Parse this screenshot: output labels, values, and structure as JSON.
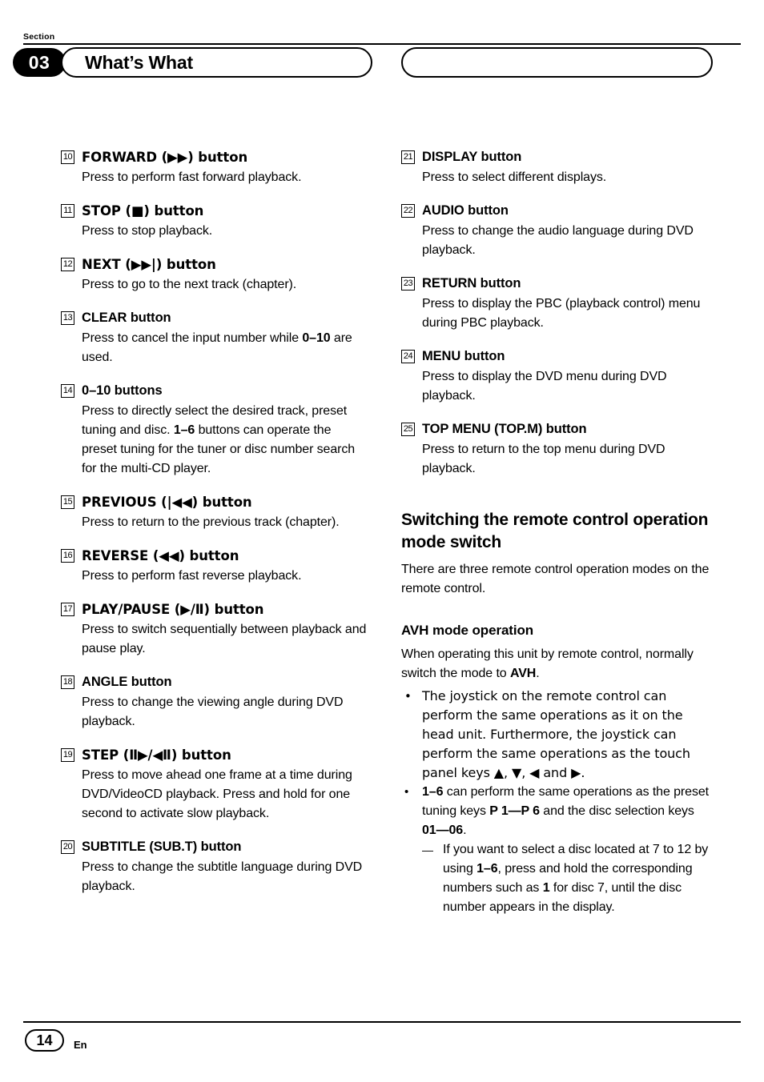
{
  "header": {
    "section_label": "Section",
    "section_number": "03",
    "title": "What’s What"
  },
  "footer": {
    "page_number": "14",
    "language": "En"
  },
  "left_column": [
    {
      "num": "10",
      "title": "FORWARD (▶▶) button",
      "body": "Press to perform fast forward playback."
    },
    {
      "num": "11",
      "title": "STOP (■) button",
      "body": "Press to stop playback."
    },
    {
      "num": "12",
      "title": "NEXT (▶▶|) button",
      "body": "Press to go to the next track (chapter)."
    },
    {
      "num": "13",
      "title": "CLEAR button",
      "body_pre": "Press to cancel the input number while ",
      "body_bold": "0–10",
      "body_post": " are used."
    },
    {
      "num": "14",
      "title": "0–10 buttons",
      "body_pre": "Press to directly select the desired track, preset tuning and disc. ",
      "body_bold": "1–6",
      "body_post": " buttons can operate the preset tuning for the tuner or disc number search for the multi-CD player."
    },
    {
      "num": "15",
      "title": "PREVIOUS (|◀◀) button",
      "body": "Press to return to the previous track (chapter)."
    },
    {
      "num": "16",
      "title": "REVERSE (◀◀) button",
      "body": "Press to perform fast reverse playback."
    },
    {
      "num": "17",
      "title": "PLAY/PAUSE (▶/Ⅱ) button",
      "body": "Press to switch sequentially between playback and pause play."
    },
    {
      "num": "18",
      "title": "ANGLE button",
      "body": "Press to change the viewing angle during DVD playback."
    },
    {
      "num": "19",
      "title": "STEP (Ⅱ▶/◀Ⅱ) button",
      "body": "Press to move ahead one frame at a time during DVD/VideoCD playback. Press and hold for one second to activate slow playback."
    },
    {
      "num": "20",
      "title": "SUBTITLE (SUB.T) button",
      "body": "Press to change the subtitle language during DVD playback."
    }
  ],
  "right_column": [
    {
      "num": "21",
      "title": "DISPLAY button",
      "body": "Press to select different displays."
    },
    {
      "num": "22",
      "title": "AUDIO button",
      "body": "Press to change the audio language during DVD playback."
    },
    {
      "num": "23",
      "title": "RETURN button",
      "body": "Press to display the PBC (playback control) menu during PBC playback."
    },
    {
      "num": "24",
      "title": "MENU button",
      "body": "Press to display the DVD menu during DVD playback."
    },
    {
      "num": "25",
      "title": "TOP MENU (TOP.M) button",
      "body": "Press to return to the top menu during DVD playback."
    }
  ],
  "switching_section": {
    "heading": "Switching the remote control operation mode switch",
    "intro": "There are three remote control operation modes on the remote control.",
    "subheading": "AVH mode operation",
    "intro2_pre": "When operating this unit by remote control, normally switch the mode to ",
    "intro2_bold": "AVH",
    "intro2_post": ".",
    "bullet1": "The joystick on the remote control can perform the same operations as it on the head unit. Furthermore, the joystick can perform the same operations as the touch panel keys ▲, ▼, ◀ and ▶.",
    "bullet2_parts": {
      "b1": "1–6",
      "t1": " can perform the same operations as the preset tuning keys ",
      "b2": "P 1—P 6",
      "t2": " and the disc selection keys ",
      "b3": "01—06",
      "t3": "."
    },
    "dash1_parts": {
      "t1": "If you want to select a disc located at 7 to 12 by using ",
      "b1": "1–6",
      "t2": ", press and hold the corresponding numbers such as ",
      "b2": "1",
      "t3": " for disc 7, until the disc number appears in the display."
    }
  }
}
